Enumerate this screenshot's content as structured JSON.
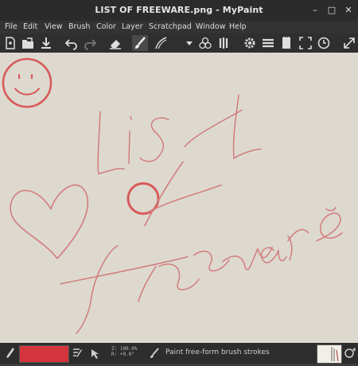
{
  "window": {
    "title": "LIST OF FREEWARE.png - MyPaint"
  },
  "window_controls": {
    "minimize": "–",
    "maximize": "□",
    "close": "✕"
  },
  "menu": [
    "File",
    "Edit",
    "View",
    "Brush",
    "Color",
    "Layer",
    "Scratchpad",
    "Window",
    "Help"
  ],
  "toolbar": {
    "icons": [
      "new-file-icon",
      "open-file-icon",
      "save-icon",
      "undo-icon",
      "redo-icon",
      "eraser-icon",
      "paintbrush-icon",
      "brush-settings-icon",
      "dropdown-icon",
      "color-circles-icon",
      "brush-presets-icon",
      "settings-icon",
      "layers-icon",
      "scratchpad-icon",
      "fullscreen-icon",
      "history-icon",
      "expand-icon"
    ]
  },
  "status": {
    "zoom_text": "Z: 100.0%",
    "rotation_text": "R: +0.0°",
    "message": "Paint free-form brush strokes",
    "color": "#d4343b"
  },
  "canvas": {
    "background": "#ddd9cf",
    "stroke_color": "#d46b6b"
  }
}
